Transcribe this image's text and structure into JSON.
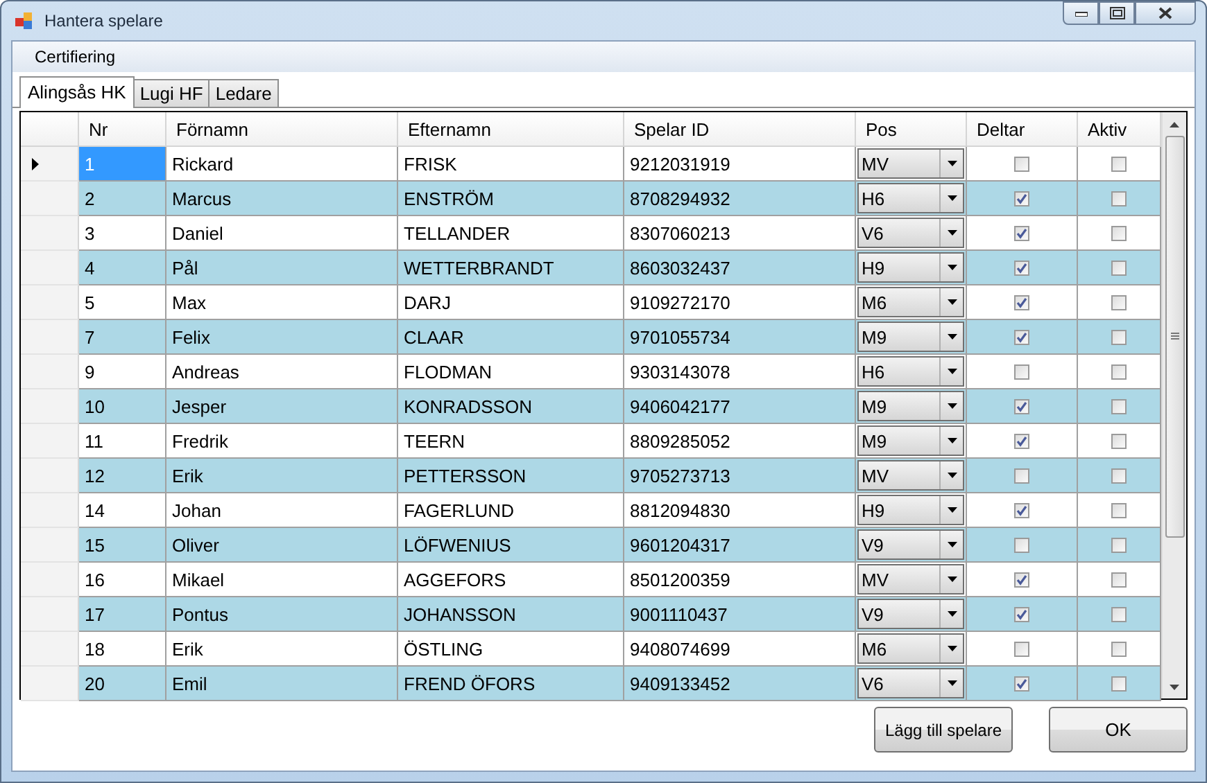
{
  "window": {
    "title": "Hantera spelare"
  },
  "menu": [
    "Certifiering"
  ],
  "tabs": [
    {
      "label": "Alingsås HK",
      "selected": true
    },
    {
      "label": "Lugi HF",
      "selected": false
    },
    {
      "label": "Ledare",
      "selected": false
    }
  ],
  "table": {
    "columns": [
      "Nr",
      "Förnamn",
      "Efternamn",
      "Spelar ID",
      "Pos",
      "Deltar",
      "Aktiv"
    ],
    "rows": [
      {
        "selected": true,
        "nr": "1",
        "first": "Rickard",
        "last": "FRISK",
        "id": "9212031919",
        "pos": "MV",
        "deltar": false,
        "aktiv": false
      },
      {
        "selected": false,
        "nr": "2",
        "first": "Marcus",
        "last": "ENSTRÖM",
        "id": "8708294932",
        "pos": "H6",
        "deltar": true,
        "aktiv": false
      },
      {
        "selected": false,
        "nr": "3",
        "first": "Daniel",
        "last": "TELLANDER",
        "id": "8307060213",
        "pos": "V6",
        "deltar": true,
        "aktiv": false
      },
      {
        "selected": false,
        "nr": "4",
        "first": "Pål",
        "last": "WETTERBRANDT",
        "id": "8603032437",
        "pos": "H9",
        "deltar": true,
        "aktiv": false
      },
      {
        "selected": false,
        "nr": "5",
        "first": "Max",
        "last": "DARJ",
        "id": "9109272170",
        "pos": "M6",
        "deltar": true,
        "aktiv": false
      },
      {
        "selected": false,
        "nr": "7",
        "first": "Felix",
        "last": "CLAAR",
        "id": "9701055734",
        "pos": "M9",
        "deltar": true,
        "aktiv": false
      },
      {
        "selected": false,
        "nr": "9",
        "first": "Andreas",
        "last": "FLODMAN",
        "id": "9303143078",
        "pos": "H6",
        "deltar": false,
        "aktiv": false
      },
      {
        "selected": false,
        "nr": "10",
        "first": "Jesper",
        "last": "KONRADSSON",
        "id": "9406042177",
        "pos": "M9",
        "deltar": true,
        "aktiv": false
      },
      {
        "selected": false,
        "nr": "11",
        "first": "Fredrik",
        "last": "TEERN",
        "id": "8809285052",
        "pos": "M9",
        "deltar": true,
        "aktiv": false
      },
      {
        "selected": false,
        "nr": "12",
        "first": "Erik",
        "last": "PETTERSSON",
        "id": "9705273713",
        "pos": "MV",
        "deltar": false,
        "aktiv": false
      },
      {
        "selected": false,
        "nr": "14",
        "first": "Johan",
        "last": "FAGERLUND",
        "id": "8812094830",
        "pos": "H9",
        "deltar": true,
        "aktiv": false
      },
      {
        "selected": false,
        "nr": "15",
        "first": "Oliver",
        "last": "LÖFWENIUS",
        "id": "9601204317",
        "pos": "V9",
        "deltar": false,
        "aktiv": false
      },
      {
        "selected": false,
        "nr": "16",
        "first": "Mikael",
        "last": "AGGEFORS",
        "id": "8501200359",
        "pos": "MV",
        "deltar": true,
        "aktiv": false
      },
      {
        "selected": false,
        "nr": "17",
        "first": "Pontus",
        "last": "JOHANSSON",
        "id": "9001110437",
        "pos": "V9",
        "deltar": true,
        "aktiv": false
      },
      {
        "selected": false,
        "nr": "18",
        "first": "Erik",
        "last": "ÖSTLING",
        "id": "9408074699",
        "pos": "M6",
        "deltar": false,
        "aktiv": false
      },
      {
        "selected": false,
        "nr": "20",
        "first": "Emil",
        "last": "FREND ÖFORS",
        "id": "9409133452",
        "pos": "V6",
        "deltar": true,
        "aktiv": false
      }
    ]
  },
  "buttons": [
    "Lägg till spelare",
    "OK"
  ]
}
